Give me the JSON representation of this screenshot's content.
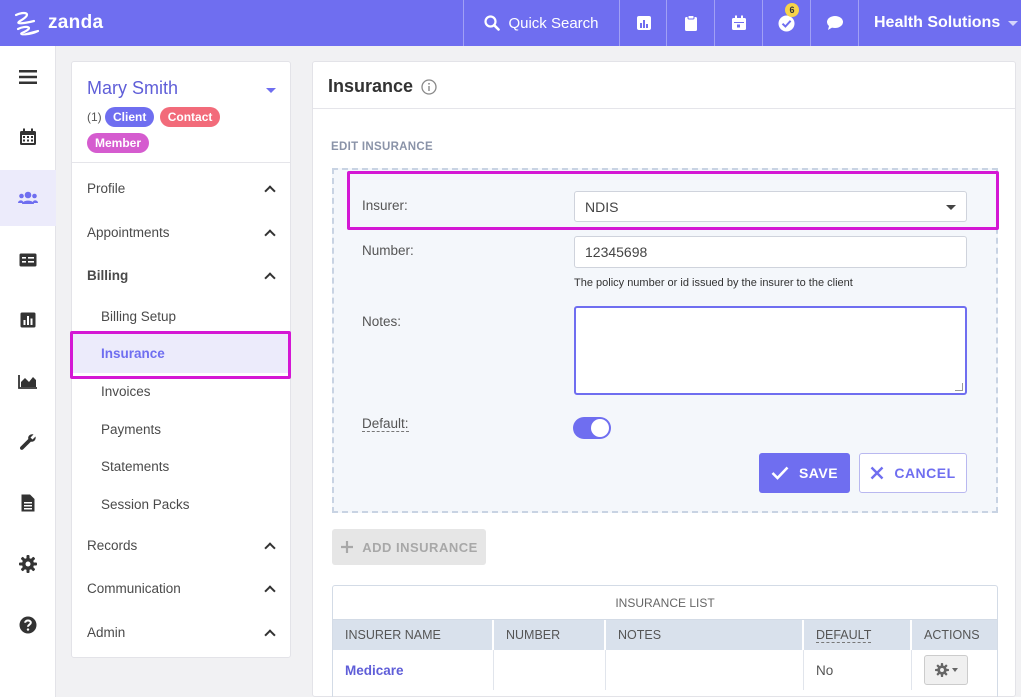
{
  "topbar": {
    "logo_text": "zanda",
    "search_label": "Quick Search",
    "tasks_badge": "6",
    "org_name": "Health Solutions"
  },
  "client": {
    "name": "Mary Smith",
    "count": "(1)",
    "tags": [
      "Client",
      "Contact",
      "Member"
    ]
  },
  "nav": {
    "profile": "Profile",
    "appointments": "Appointments",
    "billing": "Billing",
    "billing_items": [
      "Billing Setup",
      "Insurance",
      "Invoices",
      "Payments",
      "Statements",
      "Session Packs"
    ],
    "records": "Records",
    "communication": "Communication",
    "admin": "Admin"
  },
  "main": {
    "title": "Insurance",
    "edit_section": "EDIT INSURANCE",
    "form": {
      "insurer_label": "Insurer:",
      "insurer_value": "NDIS",
      "number_label": "Number:",
      "number_value": "12345698",
      "number_help": "The policy number or id issued by the insurer to the client",
      "notes_label": "Notes:",
      "notes_value": "",
      "default_label": "Default:",
      "default_on": true
    },
    "save_label": "SAVE",
    "cancel_label": "CANCEL",
    "add_label": "ADD INSURANCE",
    "table": {
      "caption": "INSURANCE LIST",
      "headers": [
        "INSURER NAME",
        "NUMBER",
        "NOTES",
        "DEFAULT",
        "ACTIONS"
      ],
      "rows": [
        {
          "insurer": "Medicare",
          "number": "",
          "notes": "",
          "default": "No"
        }
      ]
    }
  },
  "colors": {
    "brand": "#6f6ef0",
    "highlight": "#d417d4",
    "tag_contact": "#f26b7a",
    "tag_member": "#d55ccf"
  }
}
